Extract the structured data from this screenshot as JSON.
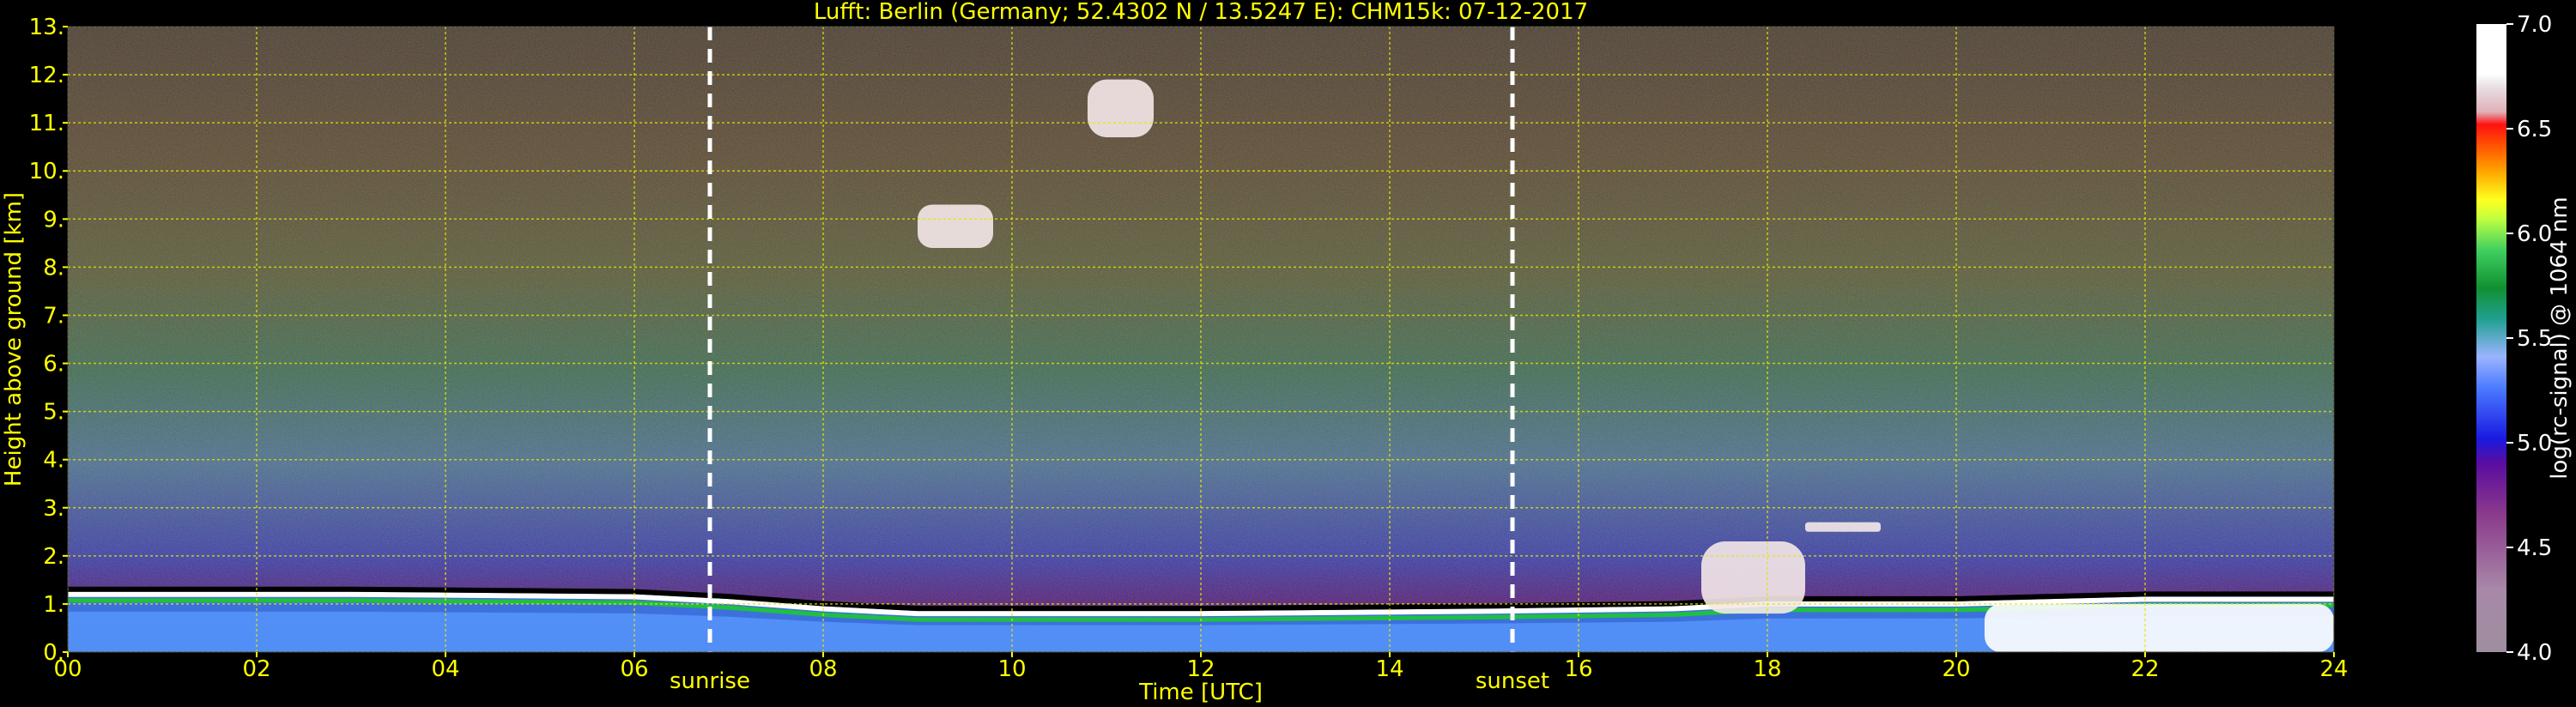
{
  "chart_data": {
    "type": "heatmap",
    "title": "Lufft: Berlin (Germany; 52.4302 N / 13.5247 E):    CHM15k: 07-12-2017",
    "xlabel": "Time [UTC]",
    "ylabel": "Height above ground [km]",
    "xlim": [
      0,
      24
    ],
    "ylim": [
      0,
      13
    ],
    "x_ticks": [
      "00",
      "02",
      "04",
      "06",
      "08",
      "10",
      "12",
      "14",
      "16",
      "18",
      "20",
      "22",
      "24"
    ],
    "y_ticks": [
      "0.",
      "1.",
      "2.",
      "3.",
      "4.",
      "5.",
      "6.",
      "7.",
      "8.",
      "9.",
      "10.",
      "11.",
      "12.",
      "13."
    ],
    "grid": true,
    "colorbar": {
      "label": "log(rc-signal) @ 1064 nm",
      "range": [
        4.0,
        7.0
      ],
      "ticks": [
        "4.0",
        "4.5",
        "5.0",
        "5.5",
        "6.0",
        "6.5",
        "7.0"
      ]
    },
    "markers": [
      {
        "label": "sunrise",
        "time": 6.8
      },
      {
        "label": "sunset",
        "time": 15.3
      }
    ],
    "boundary_layer_top_km": [
      {
        "time": 0,
        "height": 1.2
      },
      {
        "time": 3,
        "height": 1.2
      },
      {
        "time": 6,
        "height": 1.15
      },
      {
        "time": 7,
        "height": 1.05
      },
      {
        "time": 8,
        "height": 0.9
      },
      {
        "time": 9,
        "height": 0.8
      },
      {
        "time": 12,
        "height": 0.8
      },
      {
        "time": 15,
        "height": 0.85
      },
      {
        "time": 17,
        "height": 0.9
      },
      {
        "time": 18,
        "height": 1.0
      },
      {
        "time": 20,
        "height": 1.0
      },
      {
        "time": 22,
        "height": 1.1
      },
      {
        "time": 24,
        "height": 1.1
      }
    ],
    "cloud_features": [
      {
        "time_start": 9.0,
        "time_end": 9.8,
        "height_min": 8.4,
        "height_max": 9.3
      },
      {
        "time_start": 10.8,
        "time_end": 11.5,
        "height_min": 10.7,
        "height_max": 11.9
      },
      {
        "time_start": 17.3,
        "time_end": 18.4,
        "height_min": 0.8,
        "height_max": 2.3
      },
      {
        "time_start": 18.4,
        "time_end": 19.2,
        "height_min": 2.5,
        "height_max": 2.7
      },
      {
        "time_start": 20.3,
        "time_end": 24.0,
        "height_min": 0.0,
        "height_max": 1.0
      }
    ],
    "colors": {
      "background": "#000000",
      "text": "#ffff00",
      "grid": "#e6e600",
      "marker_line": "#ffffff"
    }
  }
}
